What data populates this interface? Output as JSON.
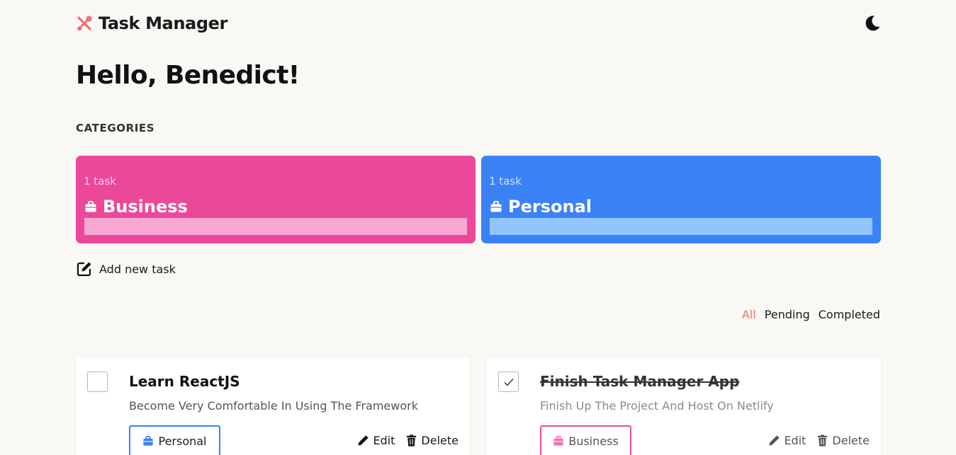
{
  "header": {
    "app_title": "Task Manager",
    "brand_icon": "tools-icon",
    "theme_icon": "moon-icon"
  },
  "greeting": "Hello, Benedict!",
  "categories_label": "CATEGORIES",
  "categories": [
    {
      "count_text": "1 task",
      "name": "Business",
      "icon": "briefcase-icon",
      "color": "#ec4899",
      "bar_color": "#f9a8d4"
    },
    {
      "count_text": "1 task",
      "name": "Personal",
      "icon": "briefcase-icon",
      "color": "#3b82f6",
      "bar_color": "#93c5fd"
    }
  ],
  "add_task_label": "Add new task",
  "filters": [
    {
      "label": "All",
      "active": true
    },
    {
      "label": "Pending",
      "active": false
    },
    {
      "label": "Completed",
      "active": false
    }
  ],
  "active_filter_color": "#f06f6f",
  "tasks": [
    {
      "title": "Learn ReactJS",
      "description": "Become Very Comfortable In Using The Framework",
      "category": "Personal",
      "completed": false,
      "edit_label": "Edit",
      "delete_label": "Delete"
    },
    {
      "title": "Finish Task Manager App",
      "description": "Finish Up The Project And Host On Netlify",
      "category": "Business",
      "completed": true,
      "edit_label": "Edit",
      "delete_label": "Delete"
    }
  ]
}
